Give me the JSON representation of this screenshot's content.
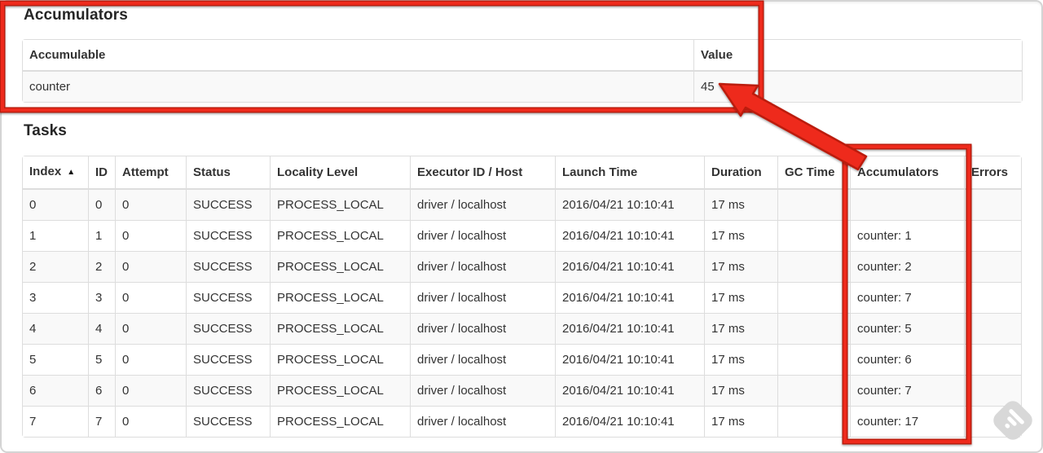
{
  "accumulators_section": {
    "title": "Accumulators",
    "table": {
      "headers": [
        "Accumulable",
        "Value"
      ],
      "rows": [
        {
          "accumulable": "counter",
          "value": "45"
        }
      ]
    }
  },
  "tasks_section": {
    "title": "Tasks",
    "table": {
      "headers": [
        "Index",
        "ID",
        "Attempt",
        "Status",
        "Locality Level",
        "Executor ID / Host",
        "Launch Time",
        "Duration",
        "GC Time",
        "Accumulators",
        "Errors"
      ],
      "sort_indicator": "▲",
      "rows": [
        {
          "index": "0",
          "id": "0",
          "attempt": "0",
          "status": "SUCCESS",
          "locality_level": "PROCESS_LOCAL",
          "executor": "driver / localhost",
          "launch_time": "2016/04/21 10:10:41",
          "duration": "17 ms",
          "gc_time": "",
          "accumulators": "",
          "errors": ""
        },
        {
          "index": "1",
          "id": "1",
          "attempt": "0",
          "status": "SUCCESS",
          "locality_level": "PROCESS_LOCAL",
          "executor": "driver / localhost",
          "launch_time": "2016/04/21 10:10:41",
          "duration": "17 ms",
          "gc_time": "",
          "accumulators": "counter: 1",
          "errors": ""
        },
        {
          "index": "2",
          "id": "2",
          "attempt": "0",
          "status": "SUCCESS",
          "locality_level": "PROCESS_LOCAL",
          "executor": "driver / localhost",
          "launch_time": "2016/04/21 10:10:41",
          "duration": "17 ms",
          "gc_time": "",
          "accumulators": "counter: 2",
          "errors": ""
        },
        {
          "index": "3",
          "id": "3",
          "attempt": "0",
          "status": "SUCCESS",
          "locality_level": "PROCESS_LOCAL",
          "executor": "driver / localhost",
          "launch_time": "2016/04/21 10:10:41",
          "duration": "17 ms",
          "gc_time": "",
          "accumulators": "counter: 7",
          "errors": ""
        },
        {
          "index": "4",
          "id": "4",
          "attempt": "0",
          "status": "SUCCESS",
          "locality_level": "PROCESS_LOCAL",
          "executor": "driver / localhost",
          "launch_time": "2016/04/21 10:10:41",
          "duration": "17 ms",
          "gc_time": "",
          "accumulators": "counter: 5",
          "errors": ""
        },
        {
          "index": "5",
          "id": "5",
          "attempt": "0",
          "status": "SUCCESS",
          "locality_level": "PROCESS_LOCAL",
          "executor": "driver / localhost",
          "launch_time": "2016/04/21 10:10:41",
          "duration": "17 ms",
          "gc_time": "",
          "accumulators": "counter: 6",
          "errors": ""
        },
        {
          "index": "6",
          "id": "6",
          "attempt": "0",
          "status": "SUCCESS",
          "locality_level": "PROCESS_LOCAL",
          "executor": "driver / localhost",
          "launch_time": "2016/04/21 10:10:41",
          "duration": "17 ms",
          "gc_time": "",
          "accumulators": "counter: 7",
          "errors": ""
        },
        {
          "index": "7",
          "id": "7",
          "attempt": "0",
          "status": "SUCCESS",
          "locality_level": "PROCESS_LOCAL",
          "executor": "driver / localhost",
          "launch_time": "2016/04/21 10:10:41",
          "duration": "17 ms",
          "gc_time": "",
          "accumulators": "counter: 17",
          "errors": ""
        }
      ]
    }
  },
  "annotations": {
    "color": "#ee2c1b",
    "edge_color": "#bb1a0d",
    "highlighted_value": "45",
    "highlighted_column": "Accumulators"
  },
  "watermark": {
    "icon": "feedly-logo",
    "color": "#d8d8d8"
  }
}
